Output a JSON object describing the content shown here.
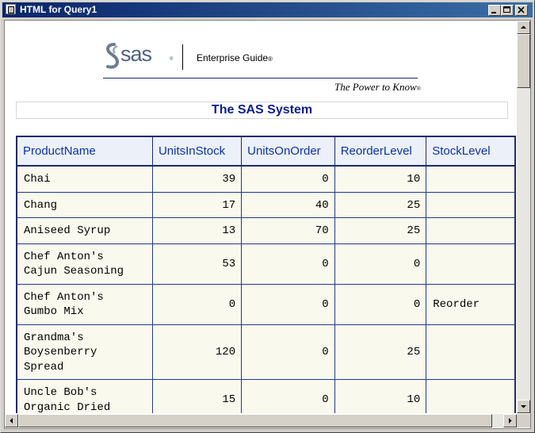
{
  "window": {
    "title": "HTML for Query1",
    "minimize_glyph": "0",
    "maximize_glyph": "1",
    "close_glyph": "r"
  },
  "logo": {
    "brand": "sas",
    "product": "Enterprise Guide",
    "registered_mark": "®",
    "tagline": "The Power to Know",
    "tagline_mark": "®"
  },
  "report": {
    "title": "The SAS System"
  },
  "table": {
    "columns": [
      "ProductName",
      "UnitsInStock",
      "UnitsOnOrder",
      "ReorderLevel",
      "StockLevel"
    ],
    "rows": [
      [
        "Chai",
        "39",
        "0",
        "10",
        ""
      ],
      [
        "Chang",
        "17",
        "40",
        "25",
        ""
      ],
      [
        "Aniseed Syrup",
        "13",
        "70",
        "25",
        ""
      ],
      [
        "Chef Anton's\nCajun Seasoning",
        "53",
        "0",
        "0",
        ""
      ],
      [
        "Chef Anton's\nGumbo Mix",
        "0",
        "0",
        "0",
        "Reorder"
      ],
      [
        "Grandma's\nBoysenberry\nSpread",
        "120",
        "0",
        "25",
        ""
      ],
      [
        "Uncle Bob's\nOrganic Dried",
        "15",
        "0",
        "10",
        ""
      ]
    ]
  },
  "scrollbars": {
    "up_icon": "up-arrow-icon",
    "down_icon": "down-arrow-icon",
    "left_icon": "left-arrow-icon",
    "right_icon": "right-arrow-icon"
  },
  "colors": {
    "titlebar_start": "#0a246a",
    "header_text": "#0b33a8",
    "header_bg": "#ecf0f8",
    "cell_bg": "#faf9ee",
    "grid_border": "#1c2b6b",
    "title_text": "#0a1f8f"
  }
}
